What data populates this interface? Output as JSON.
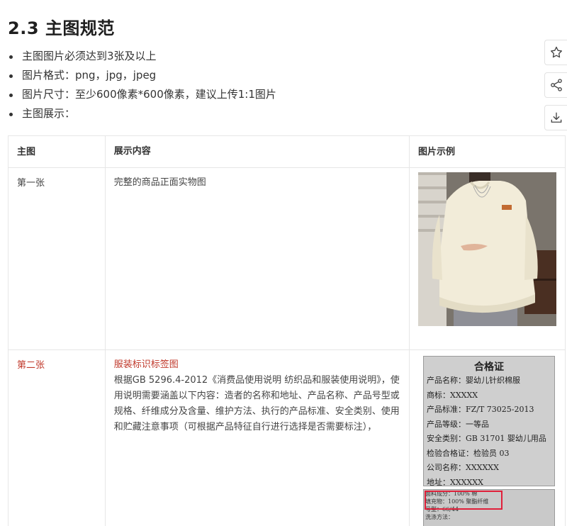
{
  "heading": "2.3 主图规范",
  "bullets": [
    "主图图片必须达到3张及以上",
    "图片格式：png，jpg，jpeg",
    "图片尺寸：至少600像素*600像素，建议上传1:1图片",
    "主图展示："
  ],
  "side_actions": [
    "star-icon",
    "share-icon",
    "download-icon"
  ],
  "table": {
    "headers": [
      "主图",
      "展示内容",
      "图片示例"
    ],
    "rows": [
      {
        "name": "第一张",
        "content_title": "",
        "content": "完整的商品正面实物图"
      },
      {
        "name": "第二张",
        "content_title": "服装标识标签图",
        "content": "根据GB 5296.4-2012《消费品使用说明 纺织品和服装使用说明》，使用说明需要涵盖以下内容：造者的名称和地址、产品名称、产品号型或规格、纤维成分及含量、维护方法、执行的产品标准、安全类别、使用和贮藏注意事项（可根据产品特征自行进行选择是否需要标注），"
      }
    ]
  },
  "label_sample": {
    "title": "合格证",
    "lines": [
      "产品名称：婴幼儿针织棉服",
      "商标：XXXXX",
      "产品标准：FZ/T 73025-2013",
      "产品等级：一等品",
      "安全类别：GB 31701 婴幼儿用品",
      "检验合格证：检验员 03",
      "公司名称：XXXXXX",
      "地址：XXXXXX"
    ],
    "small_lines": [
      "面料成分：100% 棉",
      "填充物：100% 聚酯纤维",
      "号型：66/44",
      "洗涤方法："
    ]
  },
  "colors": {
    "highlight_red": "#c0392b",
    "label_box_red": "#e0203a",
    "border": "#e6e6e6"
  }
}
